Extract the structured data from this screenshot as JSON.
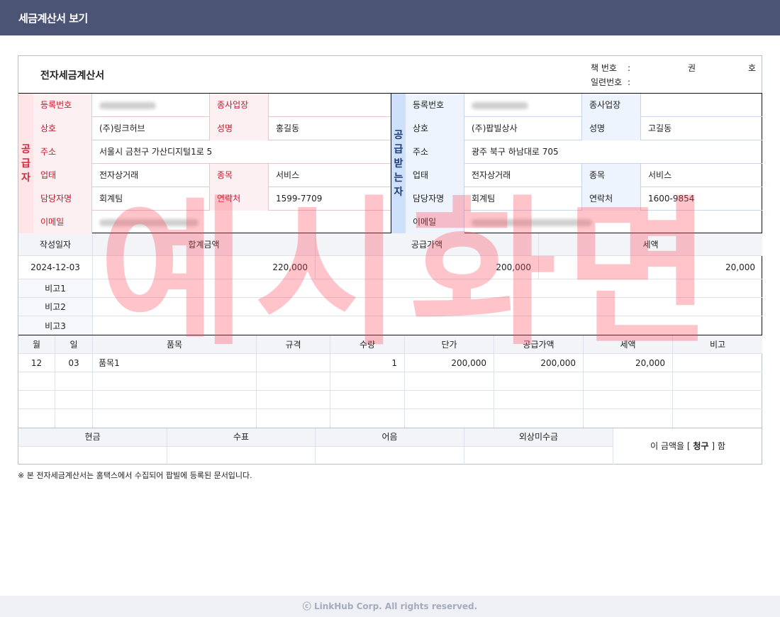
{
  "header": {
    "title": "세금계산서 보기"
  },
  "doc": {
    "title": "전자세금계산서",
    "book_no_label": "책 번호",
    "serial_no_label": "일련번호",
    "colon": ":",
    "book_vol_unit": "권",
    "book_no_unit": "호"
  },
  "supplier": {
    "side_label": [
      "공",
      "급",
      "자"
    ],
    "labels": {
      "reg_no": "등록번호",
      "branch_no": "종사업장",
      "company": "상호",
      "ceo": "성명",
      "address": "주소",
      "biz_type": "업태",
      "biz_item": "종목",
      "contact_name": "담당자명",
      "phone": "연락처",
      "email": "이메일"
    },
    "reg_no": "",
    "branch_no": "",
    "company": "(주)링크허브",
    "ceo": "홍길동",
    "address": "서울시 금천구 가산디지털1로 5",
    "biz_type": "전자상거래",
    "biz_item": "서비스",
    "contact_name": "회계팀",
    "phone": "1599-7709",
    "email": ""
  },
  "receiver": {
    "side_label": [
      "공",
      "급",
      "받",
      "는",
      "자"
    ],
    "labels": {
      "reg_no": "등록번호",
      "branch_no": "종사업장",
      "company": "상호",
      "ceo": "성명",
      "address": "주소",
      "biz_type": "업태",
      "biz_item": "종목",
      "contact_name": "담당자명",
      "phone": "연락처",
      "email": "이메일"
    },
    "reg_no": "",
    "branch_no": "",
    "company": "(주)팝빌상사",
    "ceo": "고길동",
    "address": "광주 북구 하남대로 705",
    "biz_type": "전자상거래",
    "biz_item": "서비스",
    "contact_name": "회계팀",
    "phone": "1600-9854",
    "email": ""
  },
  "amounts": {
    "headers": {
      "date": "작성일자",
      "total": "합계금액",
      "supply": "공급가액",
      "tax": "세액"
    },
    "date": "2024-12-03",
    "total": "220,000",
    "supply": "200,000",
    "tax": "20,000",
    "remark_labels": [
      "비고1",
      "비고2",
      "비고3"
    ]
  },
  "items": {
    "headers": [
      "월",
      "일",
      "품목",
      "규격",
      "수량",
      "단가",
      "공급가액",
      "세액",
      "비고"
    ],
    "rows": [
      [
        "12",
        "03",
        "품목1",
        "",
        "1",
        "200,000",
        "200,000",
        "20,000",
        ""
      ]
    ]
  },
  "payment": {
    "headers": [
      "현금",
      "수표",
      "어음",
      "외상미수금"
    ],
    "statement_prefix": "이 금액을 [",
    "statement_kind": "청구",
    "statement_suffix": "] 함"
  },
  "note": "※ 본 전자세금계산서는 홈택스에서 수집되어 팝빌에 등록된 문서입니다.",
  "watermark": "예시화면",
  "footer": "ⓒ LinkHub Corp. All rights reserved."
}
